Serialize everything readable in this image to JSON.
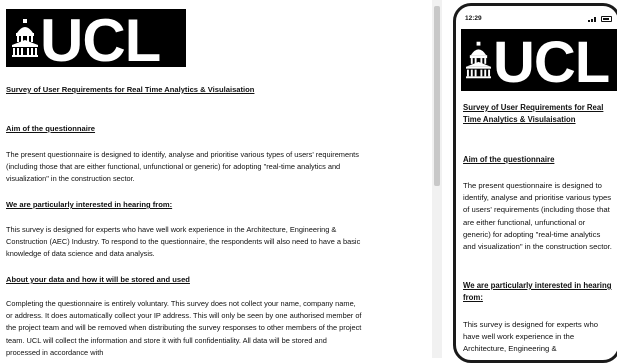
{
  "logo": {
    "text": "UCL"
  },
  "survey_title": "Survey of User Requirements for Real Time Analytics & Visulaisation",
  "sections": {
    "aim": {
      "heading": "Aim of the questionnaire",
      "body": "The present questionnaire is designed to identify, analyse and prioritise various types of users' requirements (including those that are either functional, unfunctional or generic) for adopting \"real-time analytics and visualization\" in the construction sector."
    },
    "interest": {
      "heading": "We are particularly interested in hearing from:",
      "body": "This survey is designed for experts who have well work experience in the Architecture, Engineering & Construction (AEC) Industry. To respond to the questionnaire, the respondents will also need to have a basic knowledge of data science and data analysis.",
      "mobile_body": "This survey is designed for experts who have well work experience in the Architecture, Engineering &"
    },
    "data": {
      "heading": "About your data and how it will be stored and used",
      "body": "Completing the questionnaire is entirely voluntary. This survey does not collect your name, company name, or address. It does automatically collect your IP address. This will only be seen by one authorised member of the project team and will be removed when distributing the survey responses to other members of the project team. UCL will collect the information and store it with full confidentiality. All data will be stored and processed in accordance with"
    }
  },
  "phone": {
    "time": "12:29"
  }
}
